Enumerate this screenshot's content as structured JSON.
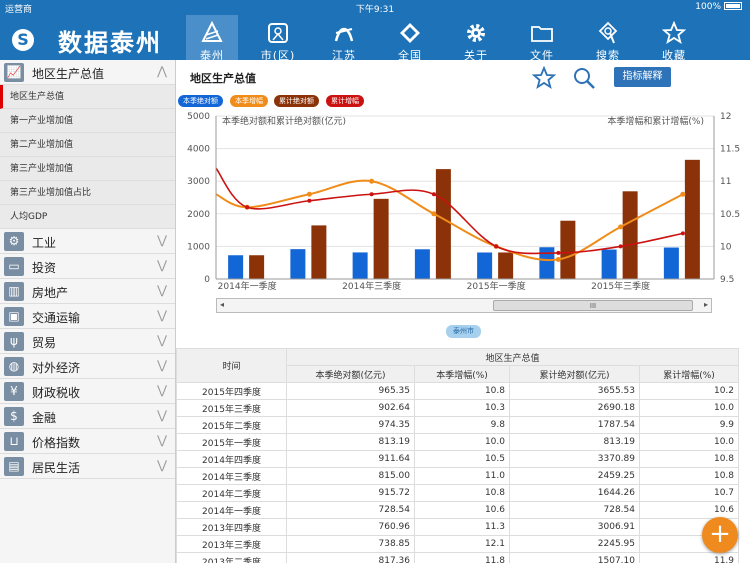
{
  "status": {
    "carrier": "运营商",
    "time": "下午9:31",
    "battery": "100%"
  },
  "app": {
    "title": "数据泰州",
    "logo_glyph": "S"
  },
  "nav": [
    {
      "label": "泰州",
      "icon": "taizhou-icon",
      "selected": true
    },
    {
      "label": "市(区)",
      "icon": "map-icon"
    },
    {
      "label": "江苏",
      "icon": "jiangsu-icon"
    },
    {
      "label": "全国",
      "icon": "diamond-icon"
    },
    {
      "label": "关于",
      "icon": "gear-icon"
    },
    {
      "label": "文件",
      "icon": "folder-icon"
    },
    {
      "label": "搜索",
      "icon": "search-icon"
    },
    {
      "label": "收藏",
      "icon": "star-icon"
    }
  ],
  "sidebar": {
    "open_category": {
      "label": "地区生产总值",
      "icon": "chart-icon"
    },
    "subitems": [
      "地区生产总值",
      "第一产业增加值",
      "第二产业增加值",
      "第三产业增加值",
      "第三产业增加值占比",
      "人均GDP"
    ],
    "categories": [
      {
        "label": "工业",
        "icon": "gear-icon"
      },
      {
        "label": "投资",
        "icon": "card-icon"
      },
      {
        "label": "房地产",
        "icon": "building-icon"
      },
      {
        "label": "交通运输",
        "icon": "bus-icon"
      },
      {
        "label": "贸易",
        "icon": "fork-icon"
      },
      {
        "label": "对外经济",
        "icon": "globe-icon"
      },
      {
        "label": "财政税收",
        "icon": "yen-icon"
      },
      {
        "label": "金融",
        "icon": "money-icon"
      },
      {
        "label": "价格指数",
        "icon": "basket-icon"
      },
      {
        "label": "居民生活",
        "icon": "wallet-icon"
      }
    ]
  },
  "main": {
    "title": "地区生产总值",
    "explain_button": "指标解释",
    "region_badge": "泰州市",
    "scroll_thumb": "III",
    "scroll_left": "◂",
    "scroll_right": "▸"
  },
  "colors": {
    "blue": "#1366d6",
    "orange": "#f08c1a",
    "brown": "#8b3208",
    "red": "#cc1111"
  },
  "chart_data": {
    "type": "bar+line",
    "left_axis_label": "本季绝对额和累计绝对额(亿元)",
    "right_axis_label": "本季增幅和累计增幅(%)",
    "y_left": {
      "min": 0,
      "max": 5000,
      "ticks": [
        "0",
        "1000",
        "2000",
        "3000",
        "4000",
        "5000"
      ]
    },
    "y_right": {
      "min": 9.5,
      "max": 12,
      "ticks": [
        "9.5",
        "10",
        "10.5",
        "11",
        "11.5",
        "12"
      ]
    },
    "x_tick_labels": [
      "2014年一季度",
      "2014年三季度",
      "2015年一季度",
      "2015年三季度"
    ],
    "series": [
      {
        "name": "本季绝对额",
        "type": "bar",
        "values": [
          728.54,
          915.72,
          815.0,
          911.64,
          813.19,
          974.35,
          902.64,
          965.35
        ]
      },
      {
        "name": "本季增幅",
        "type": "line",
        "values": [
          10.6,
          10.8,
          11.0,
          10.5,
          10.0,
          9.8,
          10.3,
          10.8
        ]
      },
      {
        "name": "累计绝对额",
        "type": "bar",
        "values": [
          728.54,
          1644.26,
          2459.25,
          3370.89,
          813.19,
          1787.54,
          2690.18,
          3655.53
        ]
      },
      {
        "name": "累计增幅",
        "type": "line",
        "values": [
          11.2,
          10.6,
          10.7,
          10.8,
          10.8,
          10.0,
          9.9,
          10.0,
          10.2
        ]
      }
    ]
  },
  "table": {
    "group_header": "地区生产总值",
    "period_header": "时间",
    "columns": [
      "本季绝对额(亿元)",
      "本季增幅(%)",
      "累计绝对额(亿元)",
      "累计增幅(%)"
    ],
    "rows": [
      [
        "2015年四季度",
        "965.35",
        "10.8",
        "3655.53",
        "10.2"
      ],
      [
        "2015年三季度",
        "902.64",
        "10.3",
        "2690.18",
        "10.0"
      ],
      [
        "2015年二季度",
        "974.35",
        "9.8",
        "1787.54",
        "9.9"
      ],
      [
        "2015年一季度",
        "813.19",
        "10.0",
        "813.19",
        "10.0"
      ],
      [
        "2014年四季度",
        "911.64",
        "10.5",
        "3370.89",
        "10.8"
      ],
      [
        "2014年三季度",
        "815.00",
        "11.0",
        "2459.25",
        "10.8"
      ],
      [
        "2014年二季度",
        "915.72",
        "10.8",
        "1644.26",
        "10.7"
      ],
      [
        "2014年一季度",
        "728.54",
        "10.6",
        "728.54",
        "10.6"
      ],
      [
        "2013年四季度",
        "760.96",
        "11.3",
        "3006.91",
        "11.8"
      ],
      [
        "2013年三季度",
        "738.85",
        "12.1",
        "2245.95",
        "11.8"
      ],
      [
        "2013年二季度",
        "817.36",
        "11.8",
        "1507.10",
        "11.9"
      ]
    ]
  }
}
